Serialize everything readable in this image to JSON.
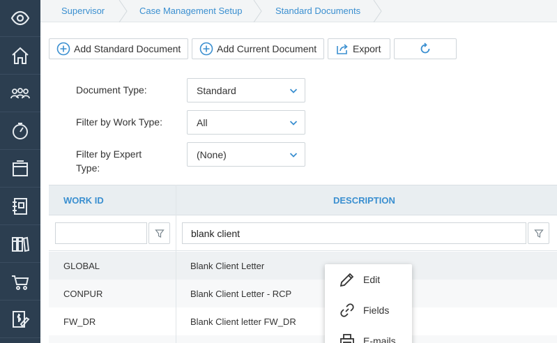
{
  "sidebar": {
    "items": [
      {
        "icon": "eye-icon"
      },
      {
        "icon": "home-icon"
      },
      {
        "icon": "users-icon"
      },
      {
        "icon": "dashboard-icon"
      },
      {
        "icon": "archive-icon"
      },
      {
        "icon": "notebook-icon"
      },
      {
        "icon": "library-icon"
      },
      {
        "icon": "cart-icon"
      },
      {
        "icon": "billing-icon"
      }
    ],
    "bg_color": "#2c3e50"
  },
  "breadcrumb": {
    "items": [
      "Supervisor",
      "Case Management Setup",
      "Standard Documents"
    ]
  },
  "toolbar": {
    "add_standard_label": "Add Standard Document",
    "add_current_label": "Add Current Document",
    "export_label": "Export"
  },
  "filters": {
    "document_type": {
      "label": "Document Type:",
      "value": "Standard"
    },
    "work_type": {
      "label": "Filter by Work Type:",
      "value": "All"
    },
    "expert_type": {
      "label_line1": "Filter by Expert",
      "label_line2": "Type:",
      "value": "(None)"
    }
  },
  "table": {
    "columns": [
      "WORK ID",
      "DESCRIPTION"
    ],
    "filter_values": {
      "work_id": "",
      "description": "blank client"
    },
    "rows": [
      {
        "work_id": "GLOBAL",
        "description": "Blank Client Letter"
      },
      {
        "work_id": "CONPUR",
        "description": "Blank Client Letter - RCP"
      },
      {
        "work_id": "FW_DR",
        "description": "Blank Client letter FW_DR"
      }
    ]
  },
  "context_menu": {
    "items": [
      {
        "label": "Edit",
        "icon": "pencil-icon"
      },
      {
        "label": "Fields",
        "icon": "link-icon"
      },
      {
        "label": "E-mails",
        "icon": "printer-icon"
      }
    ]
  },
  "colors": {
    "accent": "#3a8fd0",
    "header_bg": "#e9eef1"
  }
}
